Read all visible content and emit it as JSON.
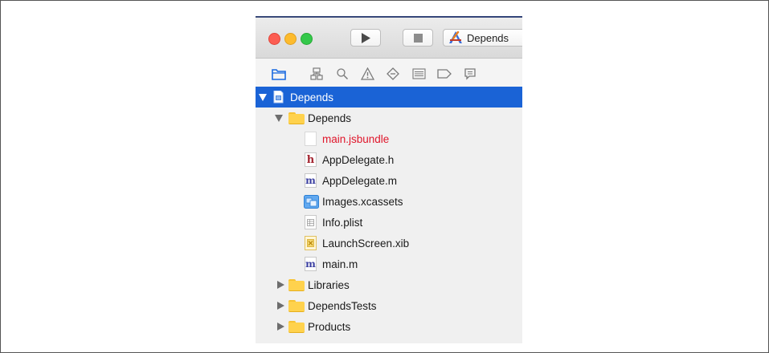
{
  "toolbar": {
    "scheme_label": "Depends"
  },
  "navigator": {
    "icons": [
      "project-navigator-icon",
      "symbol-navigator-icon",
      "find-navigator-icon",
      "issue-navigator-icon",
      "test-navigator-icon",
      "debug-navigator-icon",
      "breakpoint-navigator-icon",
      "report-navigator-icon"
    ]
  },
  "tree": {
    "project": "Depends",
    "group": "Depends",
    "files": [
      {
        "label": "main.jsbundle",
        "icon": "blank-file-icon"
      },
      {
        "label": "AppDelegate.h",
        "icon": "header-file-icon"
      },
      {
        "label": "AppDelegate.m",
        "icon": "objc-file-icon"
      },
      {
        "label": "Images.xcassets",
        "icon": "asset-catalog-icon"
      },
      {
        "label": "Info.plist",
        "icon": "plist-file-icon"
      },
      {
        "label": "LaunchScreen.xib",
        "icon": "xib-file-icon"
      },
      {
        "label": "main.m",
        "icon": "objc-file-icon"
      }
    ],
    "groups": [
      {
        "label": "Libraries"
      },
      {
        "label": "DependsTests"
      },
      {
        "label": "Products"
      }
    ]
  },
  "colors": {
    "selection": "#1a63d6",
    "missing_file": "#e0162b",
    "folder": "#ffd24d"
  }
}
